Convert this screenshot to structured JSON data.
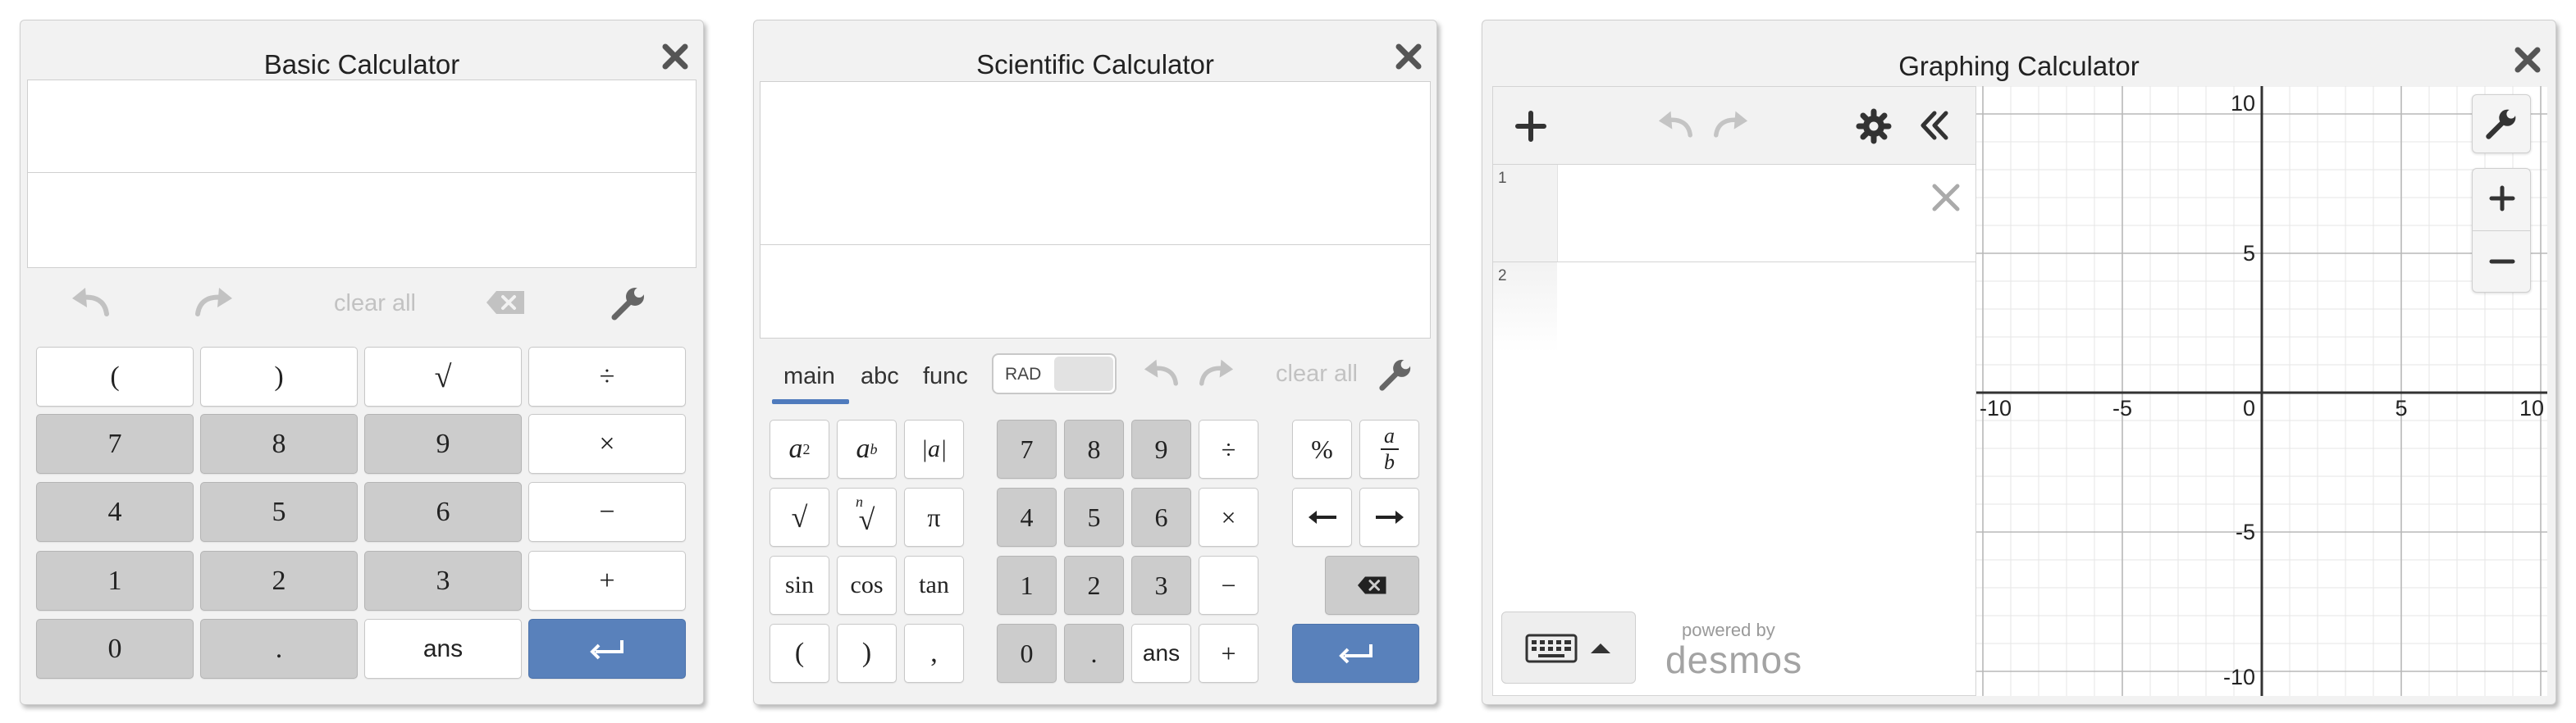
{
  "basic": {
    "title": "Basic Calculator",
    "clear_all": "clear all",
    "keys": {
      "lparen": "(",
      "rparen": ")",
      "sqrt": "√",
      "divide": "÷",
      "n7": "7",
      "n8": "8",
      "n9": "9",
      "multiply": "×",
      "n4": "4",
      "n5": "5",
      "n6": "6",
      "minus": "−",
      "n1": "1",
      "n2": "2",
      "n3": "3",
      "plus": "+",
      "n0": "0",
      "dot": ".",
      "ans": "ans"
    }
  },
  "scientific": {
    "title": "Scientific Calculator",
    "tabs": [
      "main",
      "abc",
      "func"
    ],
    "rad_label": "RAD",
    "clear_all": "clear all",
    "keys": {
      "a2_base": "a",
      "a2_exp": "2",
      "ab_base": "a",
      "ab_exp": "b",
      "abs": "|a|",
      "nroot_index": "n",
      "nroot_sym": "√",
      "sqrt": "√",
      "pi": "π",
      "sin": "sin",
      "cos": "cos",
      "tan": "tan",
      "lparen": "(",
      "rparen": ")",
      "comma": ",",
      "n7": "7",
      "n8": "8",
      "n9": "9",
      "divide": "÷",
      "n4": "4",
      "n5": "5",
      "n6": "6",
      "multiply": "×",
      "n1": "1",
      "n2": "2",
      "n3": "3",
      "minus": "−",
      "n0": "0",
      "dot": ".",
      "ans": "ans",
      "plus": "+",
      "percent": "%",
      "frac_num": "a",
      "frac_den": "b"
    }
  },
  "graphing": {
    "title": "Graphing Calculator",
    "expression_rows": [
      "1",
      "2"
    ],
    "powered_by": "powered by",
    "brand": "desmos",
    "axis": {
      "x_labels": [
        "-10",
        "-5",
        "0",
        "5",
        "10"
      ],
      "y_labels": [
        "10",
        "5",
        "-5",
        "-10"
      ],
      "x_range": [
        -10,
        10
      ],
      "y_range": [
        -10,
        10
      ],
      "minor_step": 1,
      "major_step": 5
    }
  },
  "colors": {
    "accent_blue": "#5981bb",
    "key_gray": "#cccccc",
    "panel_bg": "#f2f2f2"
  }
}
